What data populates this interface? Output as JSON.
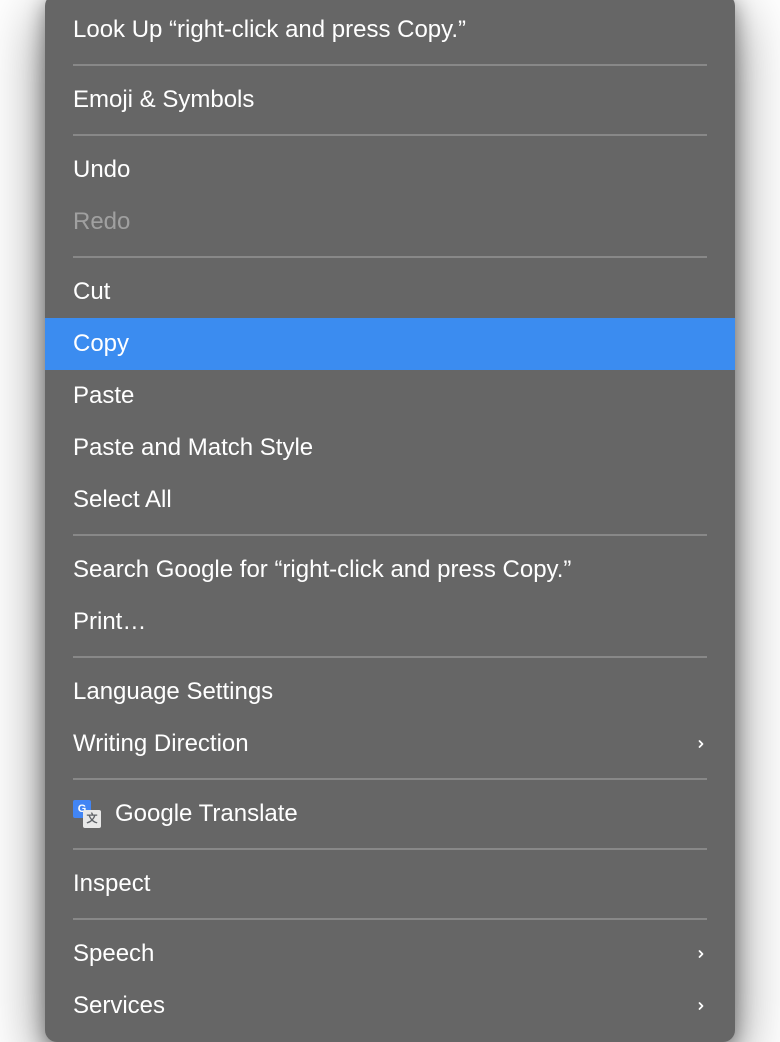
{
  "menu": {
    "lookup": "Look Up “right-click and press Copy.”",
    "emoji": "Emoji & Symbols",
    "undo": "Undo",
    "redo": "Redo",
    "cut": "Cut",
    "copy": "Copy",
    "paste": "Paste",
    "paste_match": "Paste and Match Style",
    "select_all": "Select All",
    "search_google": "Search Google for “right-click and press Copy.”",
    "print": "Print…",
    "language_settings": "Language Settings",
    "writing_direction": "Writing Direction",
    "google_translate": "Google Translate",
    "inspect": "Inspect",
    "speech": "Speech",
    "services": "Services"
  },
  "colors": {
    "highlight": "#3b8cf0",
    "background": "#666666",
    "text": "#ffffff",
    "disabled": "#a0a0a0"
  }
}
